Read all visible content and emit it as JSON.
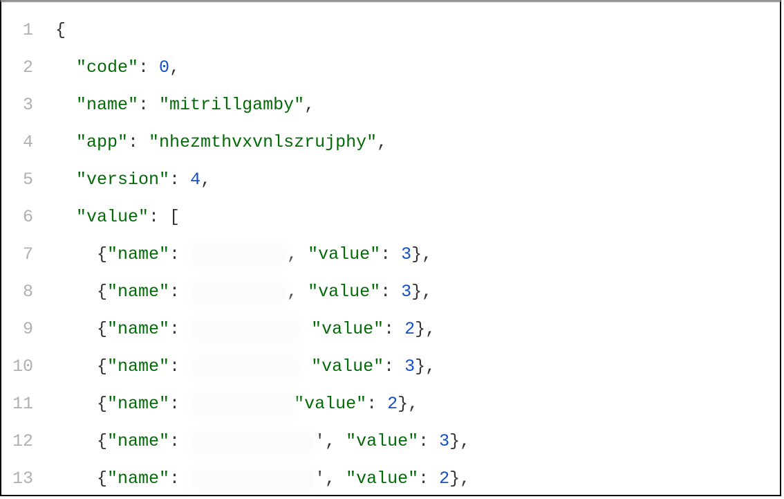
{
  "gutter": [
    "1",
    "2",
    "3",
    "4",
    "5",
    "6",
    "7",
    "8",
    "9",
    "10",
    "11",
    "12",
    "13"
  ],
  "json": {
    "code_key": "\"code\"",
    "code_val": "0",
    "name_key": "\"name\"",
    "name_val": "\"mitrillgamby\"",
    "app_key": "\"app\"",
    "app_val": "\"nhezmthvxvnlszrujphy\"",
    "version_key": "\"version\"",
    "version_val": "4",
    "value_key": "\"value\"",
    "item_name_key": "\"name\"",
    "item_value_key": "\"value\"",
    "items": [
      {
        "sep_before_value": ", ",
        "value": "3",
        "trail": "},",
        "blur_w": 140
      },
      {
        "sep_before_value": ", ",
        "value": "3",
        "trail": "},",
        "blur_w": 140
      },
      {
        "sep_before_value": " ",
        "value": "2",
        "trail": "},",
        "blur_w": 160
      },
      {
        "sep_before_value": " ",
        "value": "3",
        "trail": "},",
        "blur_w": 160
      },
      {
        "sep_before_value": "",
        "value": "2",
        "trail": "},",
        "blur_w": 150
      },
      {
        "sep_before_value": "', ",
        "value": "3",
        "trail": "},",
        "blur_w": 180
      },
      {
        "sep_before_value": "', ",
        "value": "2",
        "trail": "},",
        "blur_w": 180
      }
    ]
  }
}
